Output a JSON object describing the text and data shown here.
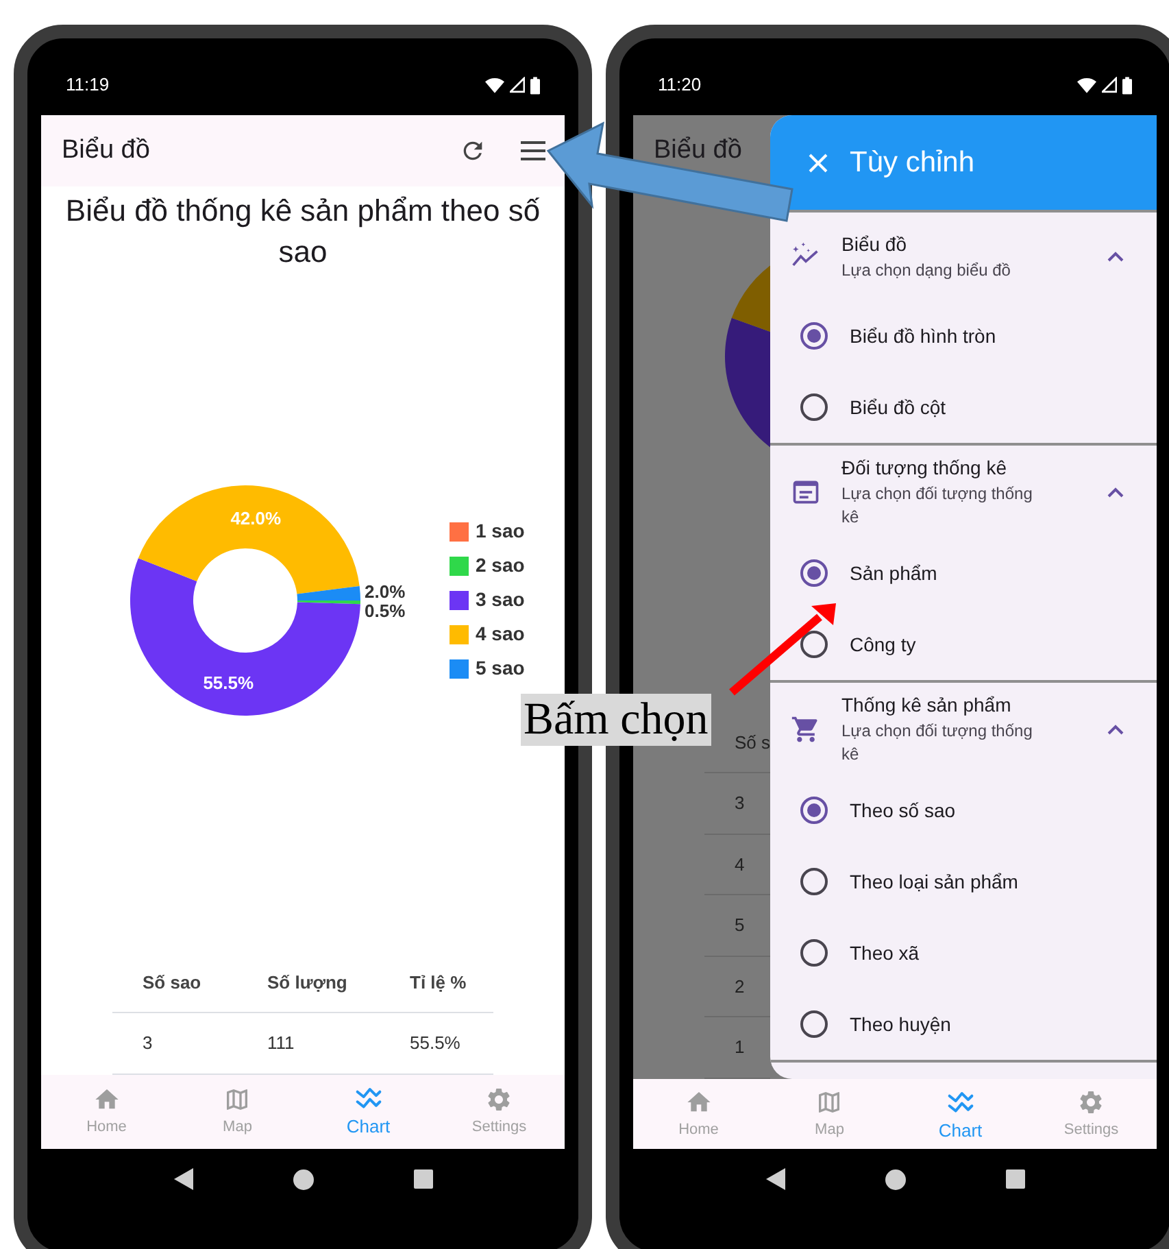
{
  "screens": [
    {
      "status_bar": {
        "time": "11:19"
      },
      "app_bar": {
        "title": "Biểu đồ"
      },
      "chart_title": "Biểu đồ thống kê sản phẩm theo số sao",
      "chart_data": {
        "type": "donut",
        "values": [
          0,
          0.5,
          55.5,
          42.0,
          2.0
        ],
        "value_labels": [
          null,
          "0.5%",
          "55.5%",
          "42.0%",
          "2.0%"
        ]
      },
      "legend": [
        {
          "label": "1 sao",
          "color": "#ff7043"
        },
        {
          "label": "2 sao",
          "color": "#2fd84a"
        },
        {
          "label": "3 sao",
          "color": "#6c35f4"
        },
        {
          "label": "4 sao",
          "color": "#ffbb00"
        },
        {
          "label": "5 sao",
          "color": "#1b8cf5"
        }
      ],
      "table": {
        "columns": [
          "Số sao",
          "Số lượng",
          "Tỉ lệ %"
        ],
        "rows": [
          [
            "3",
            "111",
            "55.5%"
          ]
        ]
      },
      "bottom_nav": [
        {
          "label": "Home",
          "selected": false
        },
        {
          "label": "Map",
          "selected": false
        },
        {
          "label": "Chart",
          "selected": true
        },
        {
          "label": "Settings",
          "selected": false
        }
      ]
    },
    {
      "status_bar": {
        "time": "11:20"
      },
      "background": {
        "app_bar_title": "Biểu đồ",
        "table_heading": "Số s",
        "row_values": [
          "3",
          "4",
          "5",
          "2",
          "1"
        ]
      },
      "drawer": {
        "title": "Tùy chỉnh",
        "sections": [
          {
            "title": "Biểu đồ",
            "subtitle": "Lựa chọn dạng biểu đồ",
            "expanded": true,
            "options": [
              {
                "label": "Biểu đồ hình tròn",
                "selected": true
              },
              {
                "label": "Biểu đồ cột",
                "selected": false
              }
            ]
          },
          {
            "title": "Đối tượng thống kê",
            "subtitle": "Lựa chọn đối tượng thống kê",
            "expanded": true,
            "options": [
              {
                "label": "Sản phẩm",
                "selected": true
              },
              {
                "label": "Công ty",
                "selected": false
              }
            ]
          },
          {
            "title": "Thống kê sản phẩm",
            "subtitle": "Lựa chọn đối tượng thống kê",
            "expanded": true,
            "options": [
              {
                "label": "Theo số sao",
                "selected": true
              },
              {
                "label": "Theo loại sản phẩm",
                "selected": false
              },
              {
                "label": "Theo xã",
                "selected": false
              },
              {
                "label": "Theo huyện",
                "selected": false
              }
            ]
          }
        ]
      },
      "bottom_nav": [
        {
          "label": "Home",
          "selected": false
        },
        {
          "label": "Map",
          "selected": false
        },
        {
          "label": "Chart",
          "selected": true
        },
        {
          "label": "Settings",
          "selected": false
        }
      ]
    }
  ],
  "annotation": {
    "label": "Bấm chọn"
  }
}
